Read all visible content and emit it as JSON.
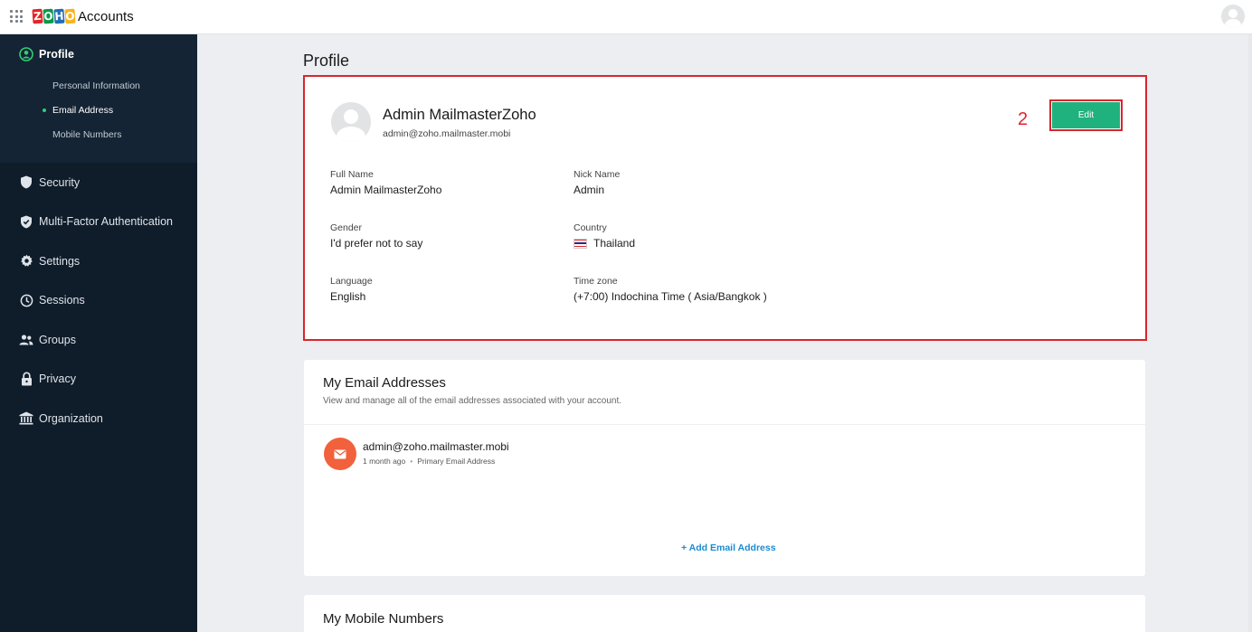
{
  "topbar": {
    "logo_letters": [
      "Z",
      "O",
      "H",
      "O"
    ],
    "logo_colors": [
      "#e42527",
      "#089949",
      "#226db4",
      "#f9b21d"
    ],
    "app_title": "Accounts"
  },
  "sidebar": {
    "profile_label": "Profile",
    "sub_items": [
      {
        "label": "Personal Information",
        "current": false
      },
      {
        "label": "Email Address",
        "current": true
      },
      {
        "label": "Mobile Numbers",
        "current": false
      }
    ],
    "items": [
      {
        "label": "Security",
        "icon": "shield-icon"
      },
      {
        "label": "Multi-Factor Authentication",
        "icon": "shield-check-icon"
      },
      {
        "label": "Settings",
        "icon": "gear-icon"
      },
      {
        "label": "Sessions",
        "icon": "clock-icon"
      },
      {
        "label": "Groups",
        "icon": "people-icon"
      },
      {
        "label": "Privacy",
        "icon": "lock-icon"
      },
      {
        "label": "Organization",
        "icon": "building-icon"
      }
    ]
  },
  "main": {
    "heading": "Profile",
    "profile": {
      "name": "Admin MailmasterZoho",
      "email": "admin@zoho.mailmaster.mobi",
      "annotation": "2",
      "edit_label": "Edit",
      "fields": {
        "full_name_label": "Full Name",
        "full_name": "Admin MailmasterZoho",
        "nick_name_label": "Nick Name",
        "nick_name": "Admin",
        "gender_label": "Gender",
        "gender": "I'd prefer not to say",
        "country_label": "Country",
        "country": "Thailand",
        "language_label": "Language",
        "language": "English",
        "timezone_label": "Time zone",
        "timezone": "(+7:00) Indochina Time ( Asia/Bangkok )"
      }
    },
    "emails": {
      "title": "My Email Addresses",
      "description": "View and manage all of the email addresses associated with your account.",
      "address": "admin@zoho.mailmaster.mobi",
      "age": "1 month ago",
      "type": "Primary Email Address",
      "add_link": "+ Add Email Address"
    },
    "mobile": {
      "title": "My Mobile Numbers"
    }
  },
  "colors": {
    "sidebar_bg": "#0f1c2a",
    "accent_green": "#1fb27e",
    "highlight_red": "#d7262c",
    "mail_badge": "#f1613b",
    "link_blue": "#1c8bd1"
  }
}
